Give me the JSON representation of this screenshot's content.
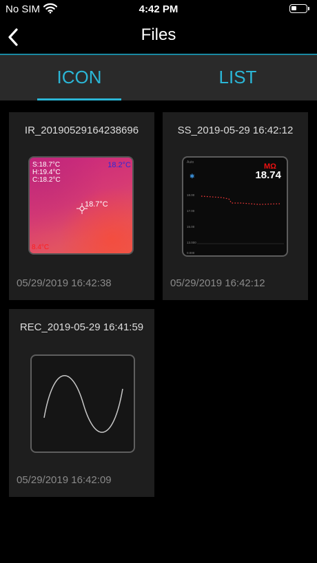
{
  "status": {
    "carrier": "No SIM",
    "time": "4:42 PM",
    "battery_level": 0.35
  },
  "nav": {
    "title": "Files",
    "back_icon": "chevron-left-icon"
  },
  "tabs": [
    {
      "label": "ICON",
      "selected": true
    },
    {
      "label": "LIST",
      "selected": false
    }
  ],
  "accent_color": "#2bb6d6",
  "files": [
    {
      "name": "IR_20190529164238696",
      "date": "05/29/2019 16:42:38",
      "kind": "thermal-image",
      "thumb": {
        "readings": [
          "S:18.7°C",
          "H:19.4°C",
          "C:18.2°C"
        ],
        "max": "18.2°C",
        "center": "18.7°C",
        "min": "8.4°C"
      }
    },
    {
      "name": "SS_2019-05-29 16:42:12",
      "date": "05/29/2019 16:42:12",
      "kind": "screenshot",
      "thumb": {
        "mode": "Auto",
        "unit": "MΩ",
        "value": "18.74",
        "y_labels": [
          "18.00",
          "17.00",
          "15.00",
          "13.000",
          "0.000"
        ]
      }
    },
    {
      "name": "REC_2019-05-29 16:41:59",
      "date": "05/29/2019 16:42:09",
      "kind": "recording",
      "thumb": {
        "icon": "sine-wave-icon"
      }
    }
  ]
}
